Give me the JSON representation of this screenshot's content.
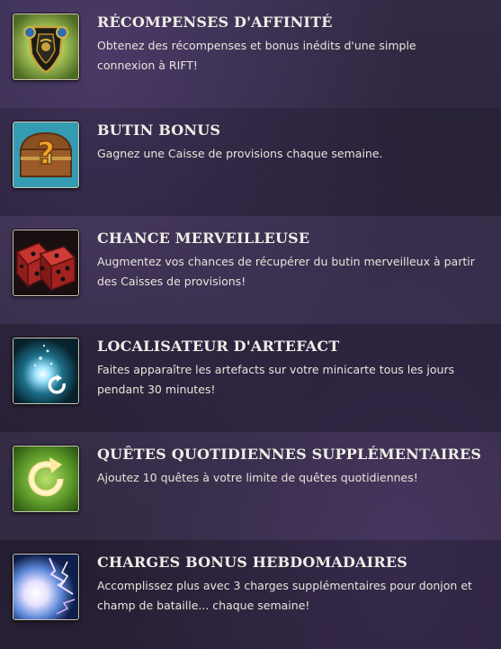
{
  "perks": [
    {
      "title": "RÉCOMPENSES D'AFFINITÉ",
      "description": "Obtenez des récompenses et bonus inédits d'une simple connexion à RIFT!",
      "icon": "shield-icon"
    },
    {
      "title": "BUTIN BONUS",
      "description": "Gagnez une Caisse de provisions chaque semaine.",
      "icon": "treasure-chest-icon"
    },
    {
      "title": "CHANCE MERVEILLEUSE",
      "description": "Augmentez vos chances de récupérer du butin merveilleux à partir des Caisses de provisions!",
      "icon": "dice-icon"
    },
    {
      "title": "LOCALISATEUR D'ARTEFACT",
      "description": "Faites apparaître les artefacts sur votre minicarte tous les jours pendant 30 minutes!",
      "icon": "sparkle-refresh-icon"
    },
    {
      "title": "QUÊTES QUOTIDIENNES SUPPLÉMENTAIRES",
      "description": "Ajoutez 10 quêtes à votre limite de quêtes quotidiennes!",
      "icon": "refresh-circle-icon"
    },
    {
      "title": "CHARGES BONUS HEBDOMADAIRES",
      "description": "Accomplissez plus avec 3 charges supplémentaires pour donjon et champ de bataille... chaque semaine!",
      "icon": "lightning-orb-icon"
    }
  ]
}
